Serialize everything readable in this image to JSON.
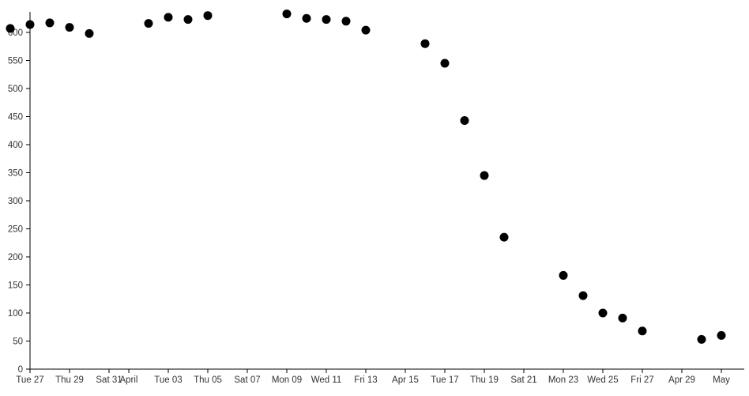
{
  "chart_data": {
    "type": "scatter",
    "title": "",
    "subtitle": "",
    "xlabel": "",
    "ylabel": "",
    "grid": false,
    "legend": null,
    "ylim": [
      0,
      640
    ],
    "xlim": [
      "2018-03-26",
      "2018-05-01"
    ],
    "marker": {
      "shape": "circle",
      "color": "#000000",
      "radius": 5.5
    },
    "y_ticks": [
      0,
      50,
      100,
      150,
      200,
      250,
      300,
      350,
      400,
      450,
      500,
      550,
      600
    ],
    "y_tick_labels": [
      "0",
      "50",
      "100",
      "150",
      "200",
      "250",
      "300",
      "350",
      "400",
      "450",
      "500",
      "550",
      "600"
    ],
    "x_ticks": [
      "Tue 27",
      "Thu 29",
      "Sat 31",
      "April",
      "Tue 03",
      "Thu 05",
      "Sat 07",
      "Mon 09",
      "Wed 11",
      "Fri 13",
      "Apr 15",
      "Tue 17",
      "Thu 19",
      "Sat 21",
      "Mon 23",
      "Wed 25",
      "Fri 27",
      "Apr 29",
      "May"
    ],
    "x_tick_days": [
      1,
      3,
      5,
      6,
      8,
      10,
      12,
      14,
      16,
      18,
      20,
      22,
      24,
      26,
      28,
      30,
      32,
      34,
      36
    ],
    "points": [
      {
        "x_day": 0,
        "x_label": "Mon 26",
        "y": 607
      },
      {
        "x_day": 1,
        "x_label": "Tue 27",
        "y": 614
      },
      {
        "x_day": 2,
        "x_label": "Wed 28",
        "y": 617
      },
      {
        "x_day": 3,
        "x_label": "Thu 29",
        "y": 609
      },
      {
        "x_day": 4,
        "x_label": "Fri 30",
        "y": 598
      },
      {
        "x_day": 7,
        "x_label": "Mon 02",
        "y": 616
      },
      {
        "x_day": 8,
        "x_label": "Tue 03",
        "y": 627
      },
      {
        "x_day": 9,
        "x_label": "Wed 04",
        "y": 623
      },
      {
        "x_day": 10,
        "x_label": "Thu 05",
        "y": 630
      },
      {
        "x_day": 14,
        "x_label": "Mon 09",
        "y": 633
      },
      {
        "x_day": 15,
        "x_label": "Tue 10",
        "y": 625
      },
      {
        "x_day": 16,
        "x_label": "Wed 11",
        "y": 623
      },
      {
        "x_day": 17,
        "x_label": "Thu 12",
        "y": 620
      },
      {
        "x_day": 18,
        "x_label": "Fri 13",
        "y": 604
      },
      {
        "x_day": 21,
        "x_label": "Mon 16",
        "y": 580
      },
      {
        "x_day": 22,
        "x_label": "Tue 17",
        "y": 545
      },
      {
        "x_day": 23,
        "x_label": "Wed 18",
        "y": 443
      },
      {
        "x_day": 24,
        "x_label": "Thu 19",
        "y": 345
      },
      {
        "x_day": 25,
        "x_label": "Fri 20",
        "y": 235
      },
      {
        "x_day": 28,
        "x_label": "Mon 23",
        "y": 167
      },
      {
        "x_day": 29,
        "x_label": "Tue 24",
        "y": 131
      },
      {
        "x_day": 30,
        "x_label": "Wed 25",
        "y": 100
      },
      {
        "x_day": 31,
        "x_label": "Thu 26",
        "y": 91
      },
      {
        "x_day": 32,
        "x_label": "Fri 27",
        "y": 68
      },
      {
        "x_day": 35,
        "x_label": "Mon 30",
        "y": 53
      },
      {
        "x_day": 36,
        "x_label": "May 01",
        "y": 60
      }
    ]
  },
  "axes": {
    "x_axis_name": "date-axis",
    "y_axis_name": "value-axis"
  }
}
